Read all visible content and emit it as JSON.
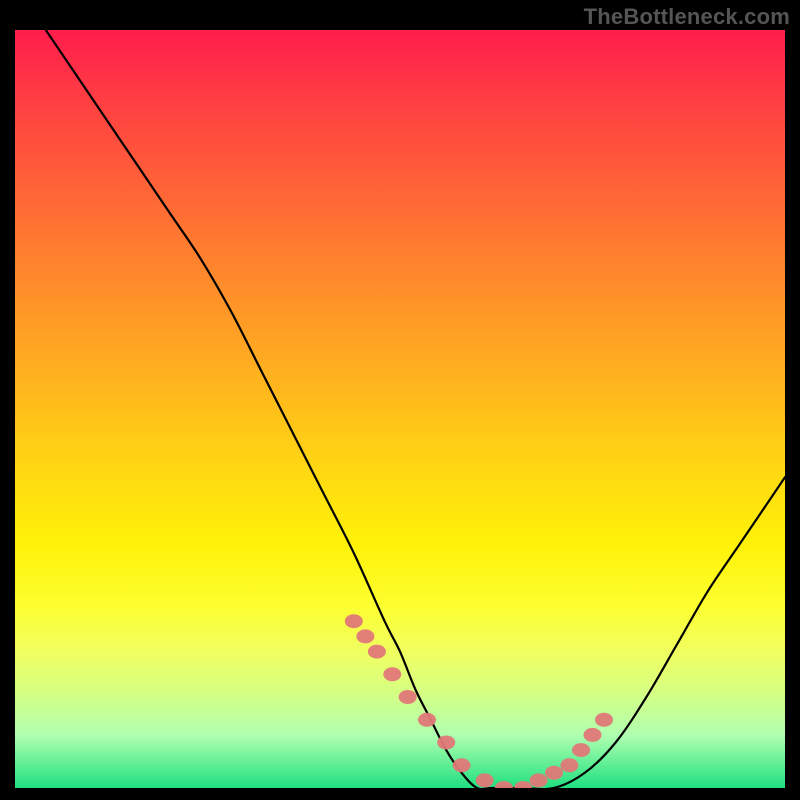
{
  "watermark": "TheBottleneck.com",
  "chart_data": {
    "type": "line",
    "title": "",
    "xlabel": "",
    "ylabel": "",
    "ylim": [
      0,
      100
    ],
    "xlim": [
      0,
      100
    ],
    "x": [
      4,
      8,
      12,
      16,
      20,
      24,
      28,
      32,
      36,
      40,
      44,
      48,
      50,
      52,
      54,
      56,
      58,
      60,
      62,
      66,
      70,
      74,
      78,
      82,
      86,
      90,
      94,
      98,
      100
    ],
    "values": [
      100,
      94,
      88,
      82,
      76,
      70,
      63,
      55,
      47,
      39,
      31,
      22,
      18,
      13,
      9,
      5,
      2,
      0,
      0,
      0,
      0,
      2,
      6,
      12,
      19,
      26,
      32,
      38,
      41
    ],
    "markers_x": [
      44,
      45.5,
      47,
      49,
      51,
      53.5,
      56,
      58,
      61,
      63.5,
      66,
      68,
      70,
      72,
      73.5,
      75,
      76.5
    ],
    "markers_y": [
      22,
      20,
      18,
      15,
      12,
      9,
      6,
      3,
      1,
      0,
      0,
      1,
      2,
      3,
      5,
      7,
      9
    ],
    "marker_color": "#e07878",
    "line_color": "#000000",
    "gradient_stops": [
      {
        "pos": 0,
        "color": "#ff1d4c"
      },
      {
        "pos": 50,
        "color": "#ffd000"
      },
      {
        "pos": 80,
        "color": "#fdff30"
      },
      {
        "pos": 100,
        "color": "#20e080"
      }
    ]
  }
}
